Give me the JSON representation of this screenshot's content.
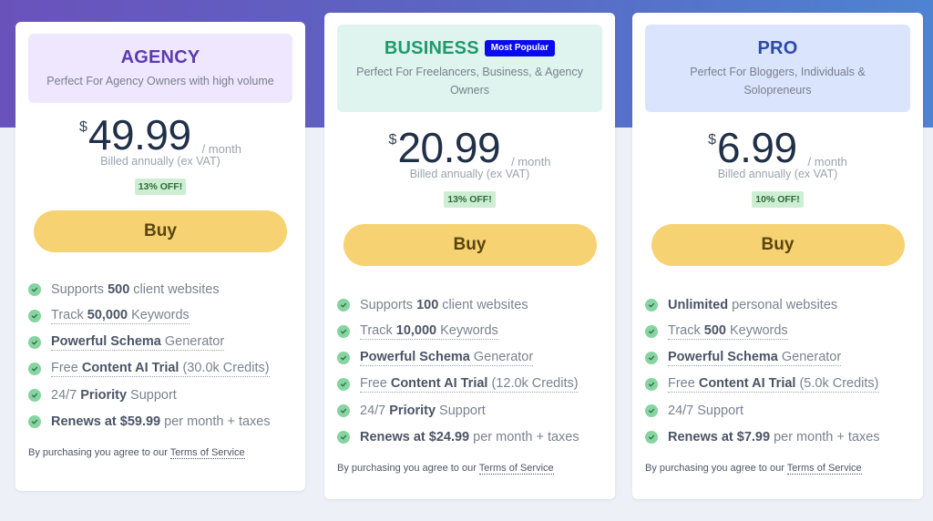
{
  "colors": {
    "hero_gradient_start": "#6a52bb",
    "hero_gradient_end": "#4e83d2",
    "buy_button": "#f7d272",
    "check": "#86d4a0",
    "popular_badge": "#0a0af0"
  },
  "plans": [
    {
      "id": "agency",
      "title": "AGENCY",
      "badge": null,
      "description": "Perfect For Agency Owners with high volume",
      "currency": "$",
      "price": "49.99",
      "period": "/ month",
      "billing": "Billed annually (ex VAT)",
      "discount": "13% OFF!",
      "buy_label": "Buy",
      "features": [
        {
          "pre": "Supports ",
          "bold": "500",
          "post": " client websites",
          "dotted": false
        },
        {
          "pre": "Track ",
          "bold": "50,000",
          "post": " Keywords",
          "dotted": true
        },
        {
          "pre": "",
          "bold": "Powerful Schema",
          "post": " Generator",
          "dotted": true
        },
        {
          "pre": "Free ",
          "bold": "Content AI Trial",
          "post": " (30.0k Credits)",
          "dotted": true
        },
        {
          "pre": "24/7 ",
          "bold": "Priority",
          "post": " Support",
          "dotted": false
        },
        {
          "pre": "",
          "bold": "Renews at $59.99",
          "post": " per month + taxes",
          "dotted": false
        }
      ],
      "tos_text": "By purchasing you agree to our ",
      "tos_link": "Terms of Service"
    },
    {
      "id": "business",
      "title": "BUSINESS",
      "badge": "Most Popular",
      "description": "Perfect For Freelancers, Business, & Agency Owners",
      "currency": "$",
      "price": "20.99",
      "period": "/ month",
      "billing": "Billed annually (ex VAT)",
      "discount": "13% OFF!",
      "buy_label": "Buy",
      "features": [
        {
          "pre": "Supports ",
          "bold": "100",
          "post": " client websites",
          "dotted": false
        },
        {
          "pre": "Track ",
          "bold": "10,000",
          "post": " Keywords",
          "dotted": true
        },
        {
          "pre": "",
          "bold": "Powerful Schema",
          "post": " Generator",
          "dotted": true
        },
        {
          "pre": "Free ",
          "bold": "Content AI Trial",
          "post": " (12.0k Credits)",
          "dotted": true
        },
        {
          "pre": "24/7 ",
          "bold": "Priority",
          "post": " Support",
          "dotted": false
        },
        {
          "pre": "",
          "bold": "Renews at $24.99",
          "post": " per month + taxes",
          "dotted": false
        }
      ],
      "tos_text": "By purchasing you agree to our ",
      "tos_link": "Terms of Service"
    },
    {
      "id": "pro",
      "title": "PRO",
      "badge": null,
      "description": "Perfect For Bloggers, Individuals & Solopreneurs",
      "currency": "$",
      "price": "6.99",
      "period": "/ month",
      "billing": "Billed annually (ex VAT)",
      "discount": "10% OFF!",
      "buy_label": "Buy",
      "features": [
        {
          "pre": "",
          "bold": "Unlimited",
          "post": " personal websites",
          "dotted": false
        },
        {
          "pre": "Track ",
          "bold": "500",
          "post": " Keywords",
          "dotted": true
        },
        {
          "pre": "",
          "bold": "Powerful Schema",
          "post": " Generator",
          "dotted": true
        },
        {
          "pre": "Free ",
          "bold": "Content AI Trial",
          "post": " (5.0k Credits)",
          "dotted": true
        },
        {
          "pre": "24/7 Support",
          "bold": "",
          "post": "",
          "dotted": false
        },
        {
          "pre": "",
          "bold": "Renews at $7.99",
          "post": " per month + taxes",
          "dotted": false
        }
      ],
      "tos_text": "By purchasing you agree to our ",
      "tos_link": "Terms of Service"
    }
  ]
}
